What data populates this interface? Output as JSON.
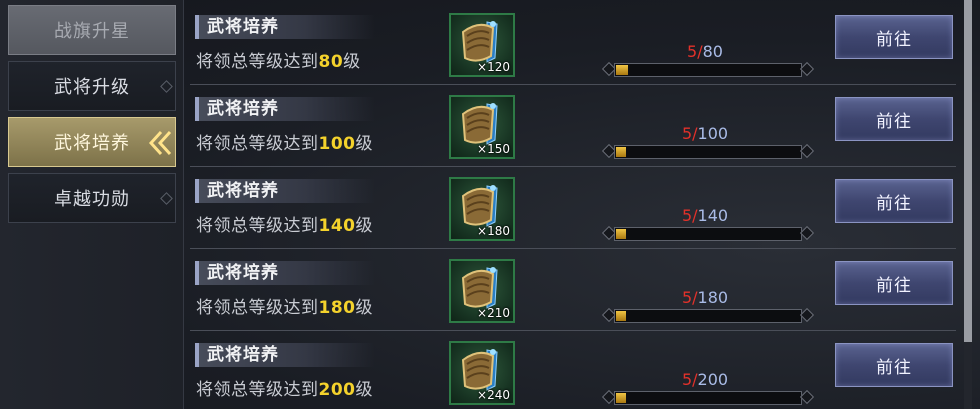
{
  "sidebar": {
    "items": [
      {
        "label": "战旗升星"
      },
      {
        "label": "武将升级"
      },
      {
        "label": "武将培养"
      },
      {
        "label": "卓越功勋"
      }
    ]
  },
  "tasks": [
    {
      "title": "武将培养",
      "desc_prefix": "将领总等级达到",
      "target": "80",
      "desc_suffix": "级",
      "reward_count": "×120",
      "current": "5",
      "slash": "/",
      "goal": "80",
      "progress": 0.0625,
      "button": "前往"
    },
    {
      "title": "武将培养",
      "desc_prefix": "将领总等级达到",
      "target": "100",
      "desc_suffix": "级",
      "reward_count": "×150",
      "current": "5",
      "slash": "/",
      "goal": "100",
      "progress": 0.05,
      "button": "前往"
    },
    {
      "title": "武将培养",
      "desc_prefix": "将领总等级达到",
      "target": "140",
      "desc_suffix": "级",
      "reward_count": "×180",
      "current": "5",
      "slash": "/",
      "goal": "140",
      "progress": 0.0357,
      "button": "前往"
    },
    {
      "title": "武将培养",
      "desc_prefix": "将领总等级达到",
      "target": "180",
      "desc_suffix": "级",
      "reward_count": "×210",
      "current": "5",
      "slash": "/",
      "goal": "180",
      "progress": 0.0278,
      "button": "前往"
    },
    {
      "title": "武将培养",
      "desc_prefix": "将领总等级达到",
      "target": "200",
      "desc_suffix": "级",
      "reward_count": "×240",
      "current": "5",
      "slash": "/",
      "goal": "200",
      "progress": 0.025,
      "button": "前往"
    }
  ],
  "colors": {
    "highlight_number": "#f4d22c",
    "current_progress": "#e2312a",
    "goal_progress": "#a9bbe6",
    "active_tab": "#a79a6b"
  },
  "icons": {
    "reward_item": "war-banner-shield-icon",
    "active_tab_marker": "double-chevron-left-icon"
  }
}
